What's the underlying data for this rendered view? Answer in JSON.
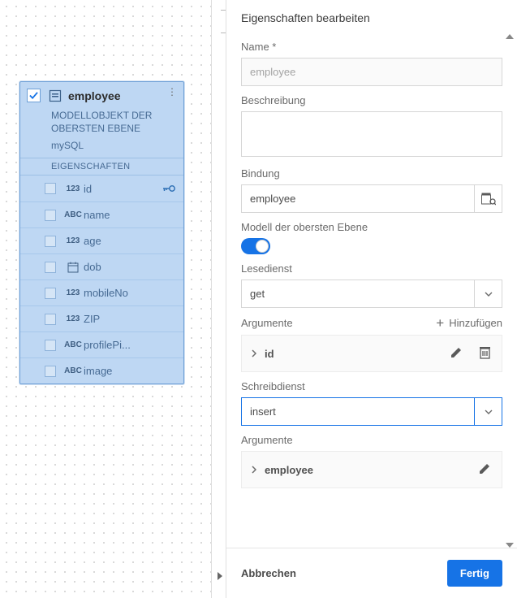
{
  "entity": {
    "title": "employee",
    "subtitle": "MODELLOBJEKT DER OBERSTEN EBENE",
    "connector": "mySQL",
    "section": "EIGENSCHAFTEN",
    "properties": [
      {
        "type": "123",
        "name": "id",
        "isKey": true
      },
      {
        "type": "ABC",
        "name": "name",
        "isKey": false
      },
      {
        "type": "123",
        "name": "age",
        "isKey": false
      },
      {
        "type": "CAL",
        "name": "dob",
        "isKey": false
      },
      {
        "type": "123",
        "name": "mobileNo",
        "isKey": false
      },
      {
        "type": "123",
        "name": "ZIP",
        "isKey": false
      },
      {
        "type": "ABC",
        "name": "profilePi...",
        "isKey": false
      },
      {
        "type": "ABC",
        "name": "image",
        "isKey": false
      }
    ]
  },
  "panel": {
    "header": "Eigenschaften bearbeiten",
    "name_label": "Name *",
    "name_value": "employee",
    "desc_label": "Beschreibung",
    "desc_value": "",
    "binding_label": "Bindung",
    "binding_value": "employee",
    "top_level_label": "Modell der obersten Ebene",
    "top_level_on": true,
    "read_svc_label": "Lesedienst",
    "read_svc_value": "get",
    "args_label": "Argumente",
    "add_label": "Hinzufügen",
    "read_args": [
      {
        "name": "id"
      }
    ],
    "write_svc_label": "Schreibdienst",
    "write_svc_value": "insert",
    "write_args": [
      {
        "name": "employee"
      }
    ]
  },
  "footer": {
    "cancel": "Abbrechen",
    "done": "Fertig"
  }
}
